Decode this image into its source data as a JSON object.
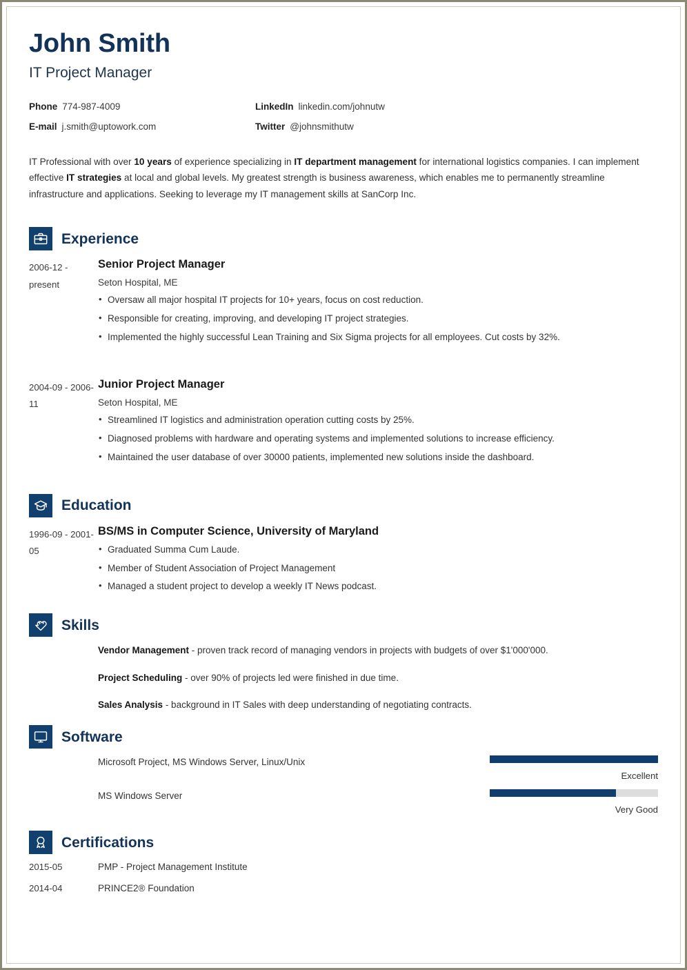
{
  "header": {
    "name": "John Smith",
    "job_title": "IT Project Manager",
    "contacts": [
      {
        "label": "Phone",
        "value": "774-987-4009",
        "icon": "phone-icon"
      },
      {
        "label": "LinkedIn",
        "value": "linkedin.com/johnutw",
        "icon": "linkedin-icon"
      },
      {
        "label": "E-mail",
        "value": "j.smith@uptowork.com",
        "icon": "email-icon"
      },
      {
        "label": "Twitter",
        "value": "@johnsmithutw",
        "icon": "twitter-icon"
      }
    ]
  },
  "summary": {
    "part1": "IT Professional with over ",
    "bold1": "10 years",
    "part2": " of experience specializing in ",
    "bold2": "IT department management",
    "part3": " for international logistics companies. I can implement effective ",
    "bold3": "IT strategies",
    "part4": " at local and global levels. My greatest strength is business awareness, which enables me to permanently streamline infrastructure and applications. Seeking to leverage my IT management skills at SanCorp Inc."
  },
  "sections": {
    "experience": {
      "title": "Experience",
      "icon": "briefcase-icon",
      "entries": [
        {
          "date": "2006-12 - present",
          "role": "Senior Project Manager",
          "org": "Seton Hospital, ME",
          "bullets": [
            "Oversaw all major hospital IT projects for 10+ years, focus on cost reduction.",
            "Responsible for creating, improving, and developing IT project strategies.",
            "Implemented the highly successful Lean Training and Six Sigma projects for all employees. Cut costs by 32%."
          ]
        },
        {
          "date": "2004-09 - 2006-11",
          "role": "Junior Project Manager",
          "org": "Seton Hospital, ME",
          "bullets": [
            "Streamlined IT logistics and administration operation cutting costs by 25%.",
            "Diagnosed problems with hardware and operating systems and implemented solutions to increase efficiency.",
            "Maintained the user database of over 30000 patients, implemented new solutions inside the dashboard."
          ]
        }
      ]
    },
    "education": {
      "title": "Education",
      "icon": "graduation-cap-icon",
      "entries": [
        {
          "date": "1996-09 - 2001-05",
          "degree": "BS/MS in Computer Science, University of Maryland",
          "bullets": [
            "Graduated Summa Cum Laude.",
            "Member of Student Association of Project Management",
            "Managed a student project to develop a weekly IT News podcast."
          ]
        }
      ]
    },
    "skills": {
      "title": "Skills",
      "icon": "puzzle-heart-icon",
      "items": [
        {
          "name": "Vendor Management",
          "desc": " - proven track record of managing vendors in projects with budgets of over $1'000'000."
        },
        {
          "name": "Project Scheduling",
          "desc": " - over 90% of projects led were finished in due time."
        },
        {
          "name": "Sales Analysis",
          "desc": " - background in IT Sales with deep understanding of negotiating contracts."
        }
      ]
    },
    "software": {
      "title": "Software",
      "icon": "monitor-icon",
      "items": [
        {
          "name": "Microsoft Project, MS Windows Server, Linux/Unix",
          "level": "Excellent",
          "percent": 100
        },
        {
          "name": "MS Windows Server",
          "level": "Very Good",
          "percent": 75
        }
      ]
    },
    "certifications": {
      "title": "Certifications",
      "icon": "award-ribbon-icon",
      "items": [
        {
          "date": "2015-05",
          "name": "PMP - Project Management Institute"
        },
        {
          "date": "2014-04",
          "name": "PRINCE2® Foundation"
        }
      ]
    }
  },
  "colors": {
    "navy_heading": "#123257",
    "icon_box": "#12406e",
    "bar_fill": "#0f3d6e",
    "bar_track": "#dddddd",
    "frame": "#8a8a74",
    "body_text": "#333333"
  }
}
